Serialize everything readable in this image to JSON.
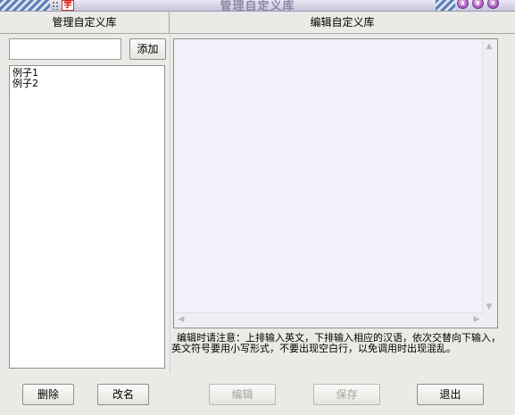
{
  "window": {
    "title": "管理自定义库",
    "app_icon_glyph": "学",
    "controls": [
      {
        "name": "minimize",
        "glyph": "∧"
      },
      {
        "name": "maximize",
        "glyph": "∨"
      },
      {
        "name": "close",
        "glyph": "×"
      }
    ]
  },
  "left_panel": {
    "header": "管理自定义库",
    "name_input_value": "",
    "add_label": "添加",
    "libraries": [
      "例子1",
      "例子2"
    ],
    "delete_label": "删除",
    "rename_label": "改名"
  },
  "right_panel": {
    "header": "编辑自定义库",
    "editor_text": "",
    "note": "编辑时请注意：上排输入英文，下排输入相应的汉语，依次交替向下输入，英文符号要用小写形式，不要出现空白行，以免调用时出现混乱。",
    "edit_label": "编辑",
    "save_label": "保存",
    "exit_label": "退出"
  },
  "colors": {
    "window_bg": "#ebeae6",
    "editor_bg": "#f1f1f9",
    "title_stripe": "#5f7fb5",
    "title_button": "#b060c8"
  },
  "icons": {
    "app": "app-logo-icon",
    "scroll_up": "arrow-up-icon",
    "scroll_down": "arrow-down-icon",
    "scroll_left": "arrow-left-icon",
    "scroll_right": "arrow-right-icon"
  }
}
